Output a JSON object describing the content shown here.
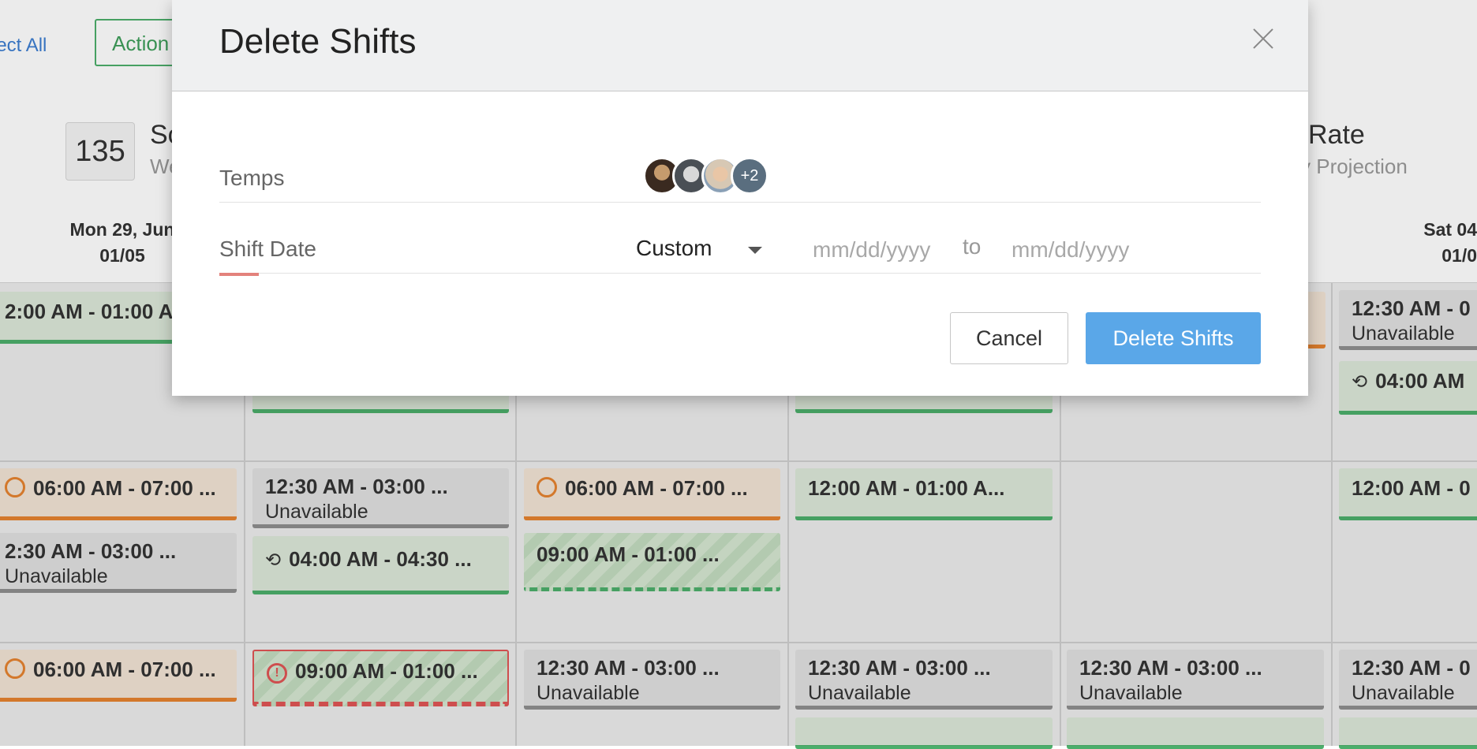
{
  "background": {
    "select_all": "lect All",
    "actions_label": "Action",
    "stat": {
      "count": "135",
      "title": "Sc",
      "sub": "We"
    },
    "rate": {
      "title": "Rate",
      "sub": "y Projection"
    },
    "days": [
      {
        "day": "Mon 29, Jun",
        "date": "01/05"
      },
      {
        "day": "Sat 04",
        "date": "01/0"
      }
    ],
    "shifts": {
      "r0c0": "2:00 AM - 01:00 A",
      "r0c5_time": "12:30 AM - 0",
      "r0c5_sub": "Unavailable",
      "r0c5b": "04:00 AM",
      "r1c0": "06:00 AM - 07:00 ...",
      "r1c0b_time": "2:30 AM - 03:00 ...",
      "r1c0b_sub": "Unavailable",
      "r1c1_time": "12:30 AM - 03:00 ...",
      "r1c1_sub": "Unavailable",
      "r1c1b": "04:00 AM - 04:30 ...",
      "r1c2": "06:00 AM - 07:00 ...",
      "r1c2b": "09:00 AM - 01:00 ...",
      "r1c3": "12:00 AM - 01:00 A...",
      "r1c5": "12:00 AM - 0",
      "r2c0": "06:00 AM - 07:00 ...",
      "r2c1": "09:00 AM - 01:00 ...",
      "r2c2_time": "12:30 AM - 03:00 ...",
      "r2c2_sub": "Unavailable",
      "r2c3_time": "12:30 AM - 03:00 ...",
      "r2c3_sub": "Unavailable",
      "r2c4_time": "12:30 AM - 03:00 ...",
      "r2c4_sub": "Unavailable",
      "r2c5_time": "12:30 AM - 0",
      "r2c5_sub": "Unavailable"
    }
  },
  "modal": {
    "title": "Delete Shifts",
    "temps_label": "Temps",
    "more_count": "+2",
    "shift_date_label": "Shift Date",
    "range_value": "Custom",
    "from_placeholder": "mm/dd/yyyy",
    "to_label": "to",
    "to_placeholder": "mm/dd/yyyy",
    "cancel_label": "Cancel",
    "delete_label": "Delete Shifts"
  }
}
